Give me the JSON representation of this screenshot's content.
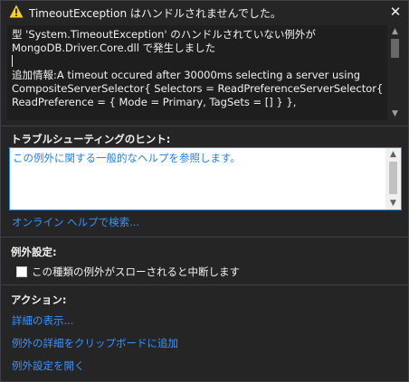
{
  "dialog": {
    "title": "TimeoutException はハンドルされませんでした。",
    "icons": {
      "warning": "warning-triangle-icon",
      "close": "close-icon"
    }
  },
  "message": {
    "lines": [
      "型 'System.TimeoutException' のハンドルされていない例外が",
      "MongoDB.Driver.Core.dll で発生しました",
      "",
      "追加情報:A timeout occured after 30000ms selecting a server using",
      "CompositeServerSelector{ Selectors = ReadPreferenceServerSelector{",
      "ReadPreference = { Mode = Primary, TagSets = [] } },"
    ]
  },
  "troubleshooting": {
    "heading": "トラブルシューティングのヒント:",
    "tip_link": "この例外に関する一般的なヘルプを参照します。",
    "online_help_link": "オンライン ヘルプで検索..."
  },
  "exception_settings": {
    "heading": "例外設定:",
    "break_checkbox_label": "この種類の例外がスローされると中断します",
    "break_checked": false
  },
  "actions": {
    "heading": "アクション:",
    "items": [
      "詳細の表示...",
      "例外の詳細をクリップボードに追加",
      "例外設定を開く"
    ]
  },
  "colors": {
    "background": "#252526",
    "text": "#f1f1f1",
    "link": "#3794ff",
    "warning": "#f8d11c",
    "focus_border": "#1e90ff"
  }
}
